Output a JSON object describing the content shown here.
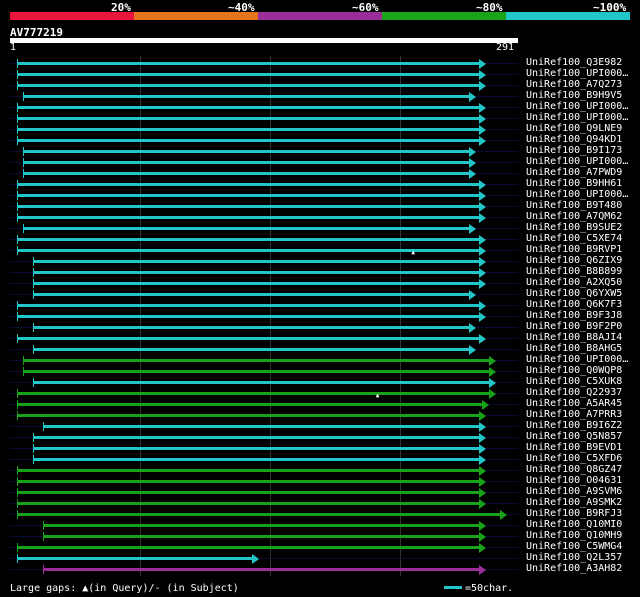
{
  "legend": {
    "segments": [
      {
        "label": "20%",
        "color": "#e8163c"
      },
      {
        "label": "~40%",
        "color": "#e8741a"
      },
      {
        "label": "~60%",
        "color": "#9b2d9b"
      },
      {
        "label": "~80%",
        "color": "#18a318"
      },
      {
        "label": "~100%",
        "color": "#23c6c8"
      }
    ]
  },
  "query": {
    "name": "AV777219",
    "start": "1",
    "end": "291",
    "length": 291
  },
  "hits": [
    {
      "name": "UniRef100_Q3E982",
      "start": 4,
      "end": 291,
      "color": "#23c6c8",
      "arrow": true
    },
    {
      "name": "UniRef100_UPI000…",
      "start": 4,
      "end": 291,
      "color": "#23c6c8",
      "arrow": true
    },
    {
      "name": "UniRef100_A7Q273",
      "start": 4,
      "end": 291,
      "color": "#23c6c8",
      "arrow": true
    },
    {
      "name": "UniRef100_B9H9V5",
      "start": 8,
      "end": 285,
      "color": "#23c6c8",
      "arrow": true
    },
    {
      "name": "UniRef100_UPI000…",
      "start": 4,
      "end": 291,
      "color": "#23c6c8",
      "arrow": true
    },
    {
      "name": "UniRef100_UPI000…",
      "start": 4,
      "end": 291,
      "color": "#23c6c8",
      "arrow": true
    },
    {
      "name": "UniRef100_Q9LNE9",
      "start": 4,
      "end": 291,
      "color": "#23c6c8",
      "arrow": true
    },
    {
      "name": "UniRef100_Q94KD1",
      "start": 4,
      "end": 291,
      "color": "#23c6c8",
      "arrow": true
    },
    {
      "name": "UniRef100_B9I173",
      "start": 8,
      "end": 285,
      "color": "#23c6c8",
      "arrow": true
    },
    {
      "name": "UniRef100_UPI000…",
      "start": 8,
      "end": 285,
      "color": "#23c6c8",
      "arrow": true
    },
    {
      "name": "UniRef100_A7PWD9",
      "start": 8,
      "end": 285,
      "color": "#23c6c8",
      "arrow": true
    },
    {
      "name": "UniRef100_B9HH61",
      "start": 4,
      "end": 291,
      "color": "#23c6c8",
      "arrow": true
    },
    {
      "name": "UniRef100_UPI000…",
      "start": 4,
      "end": 291,
      "color": "#23c6c8",
      "arrow": true
    },
    {
      "name": "UniRef100_B9T480",
      "start": 4,
      "end": 291,
      "color": "#23c6c8",
      "arrow": true
    },
    {
      "name": "UniRef100_A7QM62",
      "start": 4,
      "end": 291,
      "color": "#23c6c8",
      "arrow": true
    },
    {
      "name": "UniRef100_B9SUE2",
      "start": 8,
      "end": 285,
      "color": "#23c6c8",
      "arrow": true
    },
    {
      "name": "UniRef100_C5XE74",
      "start": 4,
      "end": 291,
      "color": "#23c6c8",
      "arrow": true
    },
    {
      "name": "UniRef100_B9RVP1",
      "start": 4,
      "end": 291,
      "color": "#23c6c8",
      "arrow": true,
      "gap": 0.79
    },
    {
      "name": "UniRef100_Q6ZIX9",
      "start": 14,
      "end": 291,
      "color": "#23c6c8",
      "arrow": true
    },
    {
      "name": "UniRef100_B8B899",
      "start": 14,
      "end": 291,
      "color": "#23c6c8",
      "arrow": true
    },
    {
      "name": "UniRef100_A2XQ50",
      "start": 14,
      "end": 291,
      "color": "#23c6c8",
      "arrow": true
    },
    {
      "name": "UniRef100_Q6YXW5",
      "start": 14,
      "end": 285,
      "color": "#23c6c8",
      "arrow": true
    },
    {
      "name": "UniRef100_Q6K7F3",
      "start": 4,
      "end": 291,
      "color": "#23c6c8",
      "arrow": true
    },
    {
      "name": "UniRef100_B9F3J8",
      "start": 4,
      "end": 291,
      "color": "#23c6c8",
      "arrow": true
    },
    {
      "name": "UniRef100_B9F2P0",
      "start": 14,
      "end": 285,
      "color": "#23c6c8",
      "arrow": true
    },
    {
      "name": "UniRef100_B8AJI4",
      "start": 4,
      "end": 291,
      "color": "#23c6c8",
      "arrow": true
    },
    {
      "name": "UniRef100_B8AHG5",
      "start": 14,
      "end": 285,
      "color": "#23c6c8",
      "arrow": true
    },
    {
      "name": "UniRef100_UPI000…",
      "start": 8,
      "end": 297,
      "color": "#18a318",
      "arrow": true
    },
    {
      "name": "UniRef100_Q0WQP8",
      "start": 8,
      "end": 297,
      "color": "#18a318",
      "arrow": true
    },
    {
      "name": "UniRef100_C5XUK8",
      "start": 14,
      "end": 297,
      "color": "#23c6c8",
      "arrow": true
    },
    {
      "name": "UniRef100_Q22937",
      "start": 4,
      "end": 297,
      "color": "#18a318",
      "arrow": true,
      "gap": 0.72
    },
    {
      "name": "UniRef100_A5AR45",
      "start": 4,
      "end": 293,
      "color": "#18a318",
      "arrow": true
    },
    {
      "name": "UniRef100_A7PRR3",
      "start": 4,
      "end": 291,
      "color": "#18a318",
      "arrow": true
    },
    {
      "name": "UniRef100_B9I6Z2",
      "start": 20,
      "end": 291,
      "color": "#23c6c8",
      "arrow": true
    },
    {
      "name": "UniRef100_Q5N857",
      "start": 14,
      "end": 291,
      "color": "#23c6c8",
      "arrow": true
    },
    {
      "name": "UniRef100_B9EVD1",
      "start": 14,
      "end": 291,
      "color": "#23c6c8",
      "arrow": true
    },
    {
      "name": "UniRef100_C5XFD6",
      "start": 14,
      "end": 291,
      "color": "#23c6c8",
      "arrow": true
    },
    {
      "name": "UniRef100_Q8GZ47",
      "start": 4,
      "end": 291,
      "color": "#18a318",
      "arrow": true
    },
    {
      "name": "UniRef100_O04631",
      "start": 4,
      "end": 291,
      "color": "#18a318",
      "arrow": true
    },
    {
      "name": "UniRef100_A9SVM6",
      "start": 4,
      "end": 291,
      "color": "#18a318",
      "arrow": true
    },
    {
      "name": "UniRef100_A9SMK2",
      "start": 4,
      "end": 291,
      "color": "#18a318",
      "arrow": true
    },
    {
      "name": "UniRef100_B9RFJ3",
      "start": 4,
      "end": 304,
      "color": "#18a318",
      "arrow": true
    },
    {
      "name": "UniRef100_Q10MI0",
      "start": 20,
      "end": 291,
      "color": "#18a318",
      "arrow": true
    },
    {
      "name": "UniRef100_Q10MH9",
      "start": 20,
      "end": 291,
      "color": "#18a318",
      "arrow": true
    },
    {
      "name": "UniRef100_C5WMG4",
      "start": 4,
      "end": 291,
      "color": "#18a318",
      "arrow": true
    },
    {
      "name": "UniRef100_Q2L357",
      "start": 4,
      "end": 152,
      "color": "#23c6c8",
      "arrow": true
    },
    {
      "name": "UniRef100_A3AH82",
      "start": 20,
      "end": 291,
      "color": "#9b2d9b",
      "arrow": true
    }
  ],
  "footer": {
    "gaps_text": "Large gaps: ▲(in Query)/- (in Subject)",
    "scale_text": "=50char."
  }
}
